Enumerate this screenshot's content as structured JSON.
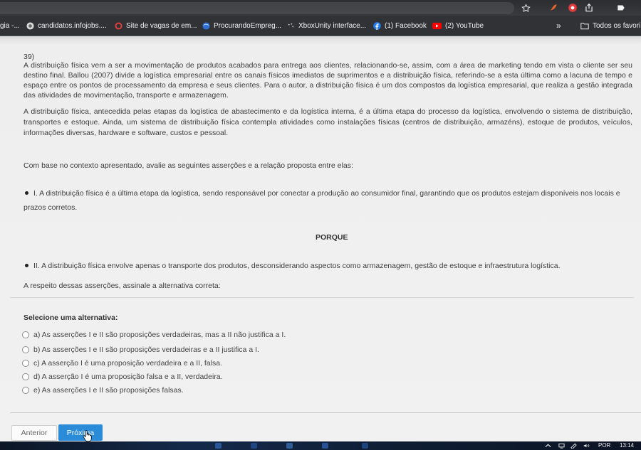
{
  "browser": {
    "bookmarks": [
      {
        "label": "gia -...",
        "icon": "none"
      },
      {
        "label": "candidatos.infojobs....",
        "icon": "infojobs-icon"
      },
      {
        "label": "Site de vagas de em...",
        "icon": "ring-icon"
      },
      {
        "label": "ProcurandoEmpreg...",
        "icon": "globe-icon"
      },
      {
        "label": "XboxUnity interface...",
        "icon": "page-icon"
      },
      {
        "label": "(1) Facebook",
        "icon": "facebook-icon"
      },
      {
        "label": "(2) YouTube",
        "icon": "youtube-icon"
      }
    ],
    "overflow_label": "»",
    "all_bookmarks_label": "Todos os favori",
    "toolbar_icons": [
      "star-icon",
      "extension-icon",
      "record-icon",
      "share-icon",
      "profile-icon"
    ]
  },
  "question": {
    "number": "39)",
    "paragraphs": [
      "A distribuição física vem a ser a movimentação de produtos acabados para entrega aos clientes, relacionando-se, assim, com a área de marketing tendo em vista o cliente ser seu destino final. Ballou (2007) divide a logística empresarial entre os canais físicos imediatos de suprimentos e a distribuição física, referindo-se a esta última como a lacuna de tempo e espaço entre os pontos de processamento da empresa e seus clientes. Para o autor, a distribuição física é um dos compostos da logística empresarial, que realiza a gestão integrada das atividades de movimentação, transporte e armazenagem.",
      "A distribuição física, antecedida pelas etapas da logística de abastecimento e da logística interna, é a última etapa do processo da logística, envolvendo o sistema de distribuição, transportes e estoque. Ainda, um sistema de distribuição física contempla atividades como instalações físicas (centros de distribuição, armazéns), estoque de produtos, veículos, informações diversas, hardware e software, custos e pessoal."
    ],
    "prompt": "Com base no contexto apresentado, avalie as seguintes asserções e a relação proposta entre elas:",
    "assertion_1": "I. A distribuição física é a última etapa da logística, sendo responsável por conectar a produção ao consumidor final, garantindo que os produtos estejam disponíveis nos locais e prazos corretos.",
    "connector": "PORQUE",
    "assertion_2": "II. A distribuição física envolve apenas o transporte dos produtos, desconsiderando aspectos como armazenagem, gestão de estoque e infraestrutura logística.",
    "instruction": "A respeito dessas asserções, assinale a alternativa correta:"
  },
  "answers": {
    "heading": "Selecione uma alternativa:",
    "options": [
      {
        "label": "a) As asserções I e II são proposições verdadeiras, mas a II não justifica a I."
      },
      {
        "label": "b) As asserções I e II são proposições verdadeiras e a II justifica a I."
      },
      {
        "label": "c) A asserção I é uma proposição verdadeira e a II, falsa."
      },
      {
        "label": "d) A asserção I é uma proposição falsa e a II, verdadeira."
      },
      {
        "label": "e) As asserções I e II são proposições falsas."
      }
    ]
  },
  "navigation": {
    "previous_label": "Anterior",
    "next_label": "Próxima"
  },
  "taskbar": {
    "language": "POR",
    "time": "13:14"
  },
  "colors": {
    "chrome_dark": "#313235",
    "page_bg": "#efefef",
    "text": "#3d3d3d",
    "primary_button": "#2a8bd8",
    "taskbar": "#0f1d33"
  }
}
